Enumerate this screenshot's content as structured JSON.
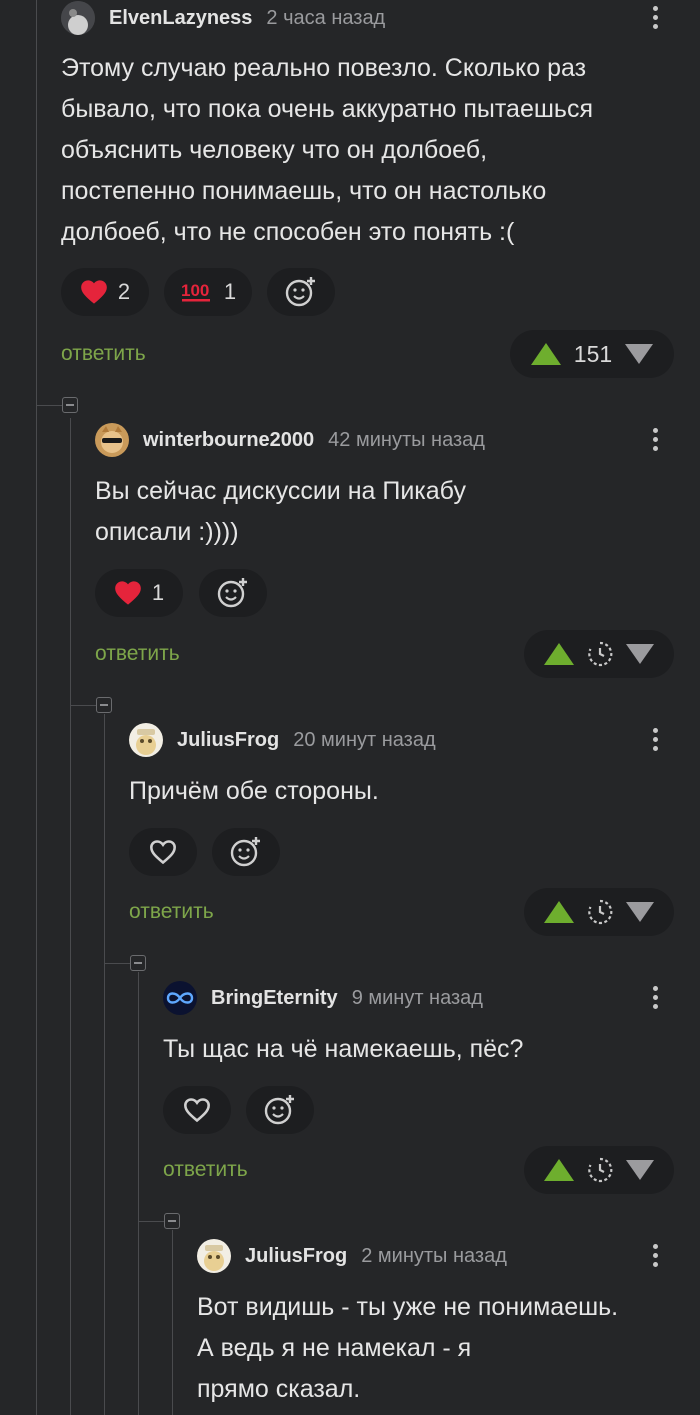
{
  "comments": [
    {
      "author": "ElvenLazyness",
      "time": "2 часа назад",
      "text": "Этому случаю реально повезло. Сколько раз\nбывало, что пока очень аккуратно пытаешься\nобъяснить человеку что он долбоеб,\nпостепенно понимаешь, что он настолько\nдолбоеб, что не способен это понять :(",
      "reactions": [
        {
          "icon": "heart-filled-icon",
          "count": "2"
        },
        {
          "icon": "hundred-points-icon",
          "count": "1"
        }
      ],
      "reply_label": "ответить",
      "rating": "151"
    },
    {
      "author": "winterbourne2000",
      "time": "42 минуты назад",
      "text": "Вы сейчас дискуссии на Пикабу\nописали :))))",
      "reactions": [
        {
          "icon": "heart-filled-icon",
          "count": "1"
        }
      ],
      "reply_label": "ответить",
      "rating": ""
    },
    {
      "author": "JuliusFrog",
      "time": "20 минут назад",
      "text": "Причём обе стороны.",
      "reactions": [],
      "reply_label": "ответить",
      "rating": ""
    },
    {
      "author": "BringEternity",
      "time": "9 минут назад",
      "text": "Ты щас на чё намекаешь, пёс?",
      "reactions": [],
      "reply_label": "ответить",
      "rating": ""
    },
    {
      "author": "JuliusFrog",
      "time": "2 минуты назад",
      "text": "Вот видишь - ты уже не понимаешь.\nА ведь я не намекал - я\nпрямо сказал.",
      "reactions": [],
      "reply_label": "",
      "rating": ""
    }
  ],
  "colors": {
    "background": "#252628",
    "pill": "#1d1e20",
    "reply": "#7ea64a",
    "upvote": "#6eae2e",
    "heart": "#e5243b"
  }
}
